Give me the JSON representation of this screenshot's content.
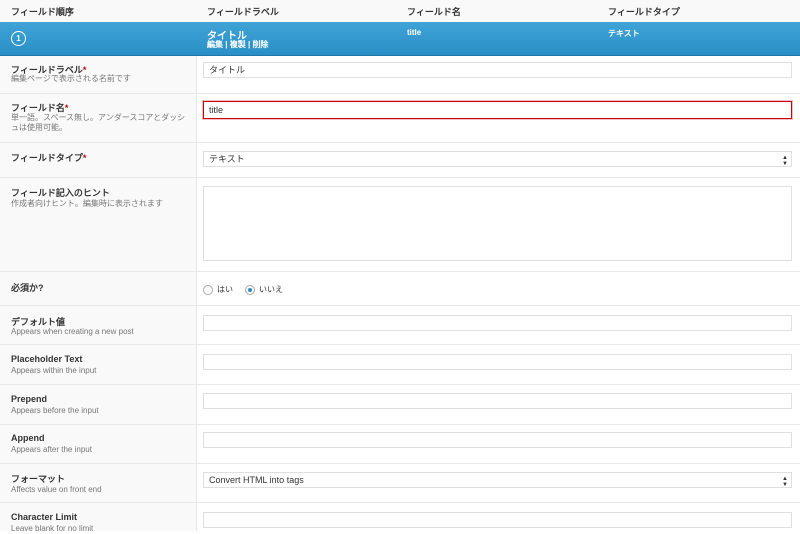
{
  "header": {
    "col_order": "フィールド順序",
    "col_label": "フィールドラベル",
    "col_name": "フィールド名",
    "col_type": "フィールドタイプ"
  },
  "field_row": {
    "order": "1",
    "label": "タイトル",
    "name": "title",
    "type": "テキスト",
    "action_edit": "編集",
    "action_duplicate": "複製",
    "action_delete": "削除",
    "sep": "|"
  },
  "settings": {
    "field_label": {
      "title": "フィールドラベル",
      "required": "*",
      "desc": "編集ページで表示される名前です",
      "value": "タイトル"
    },
    "field_name": {
      "title": "フィールド名",
      "required": "*",
      "desc": "単一語。スペース無し。アンダースコアとダッシュは使用可能。",
      "value": "title"
    },
    "field_type": {
      "title": "フィールドタイプ",
      "required": "*",
      "value": "テキスト"
    },
    "instructions": {
      "title": "フィールド記入のヒント",
      "desc": "作成者向けヒント。編集時に表示されます",
      "value": ""
    },
    "required_q": {
      "title": "必須か?",
      "opt_yes": "はい",
      "opt_no": "いいえ",
      "selected": "いいえ"
    },
    "default_value": {
      "title": "デフォルト値",
      "desc": "Appears when creating a new post",
      "value": ""
    },
    "placeholder": {
      "title": "Placeholder Text",
      "desc": "Appears within the input",
      "value": ""
    },
    "prepend": {
      "title": "Prepend",
      "desc": "Appears before the input",
      "value": ""
    },
    "append": {
      "title": "Append",
      "desc": "Appears after the input",
      "value": ""
    },
    "formatting": {
      "title": "フォーマット",
      "desc": "Affects value on front end",
      "value": "Convert HTML into tags"
    },
    "char_limit": {
      "title": "Character Limit",
      "desc": "Leave blank for no limit",
      "value": ""
    }
  },
  "colors": {
    "accent": "#2a8fc6",
    "required": "#cc0000",
    "focus_border": "#cc0000"
  }
}
